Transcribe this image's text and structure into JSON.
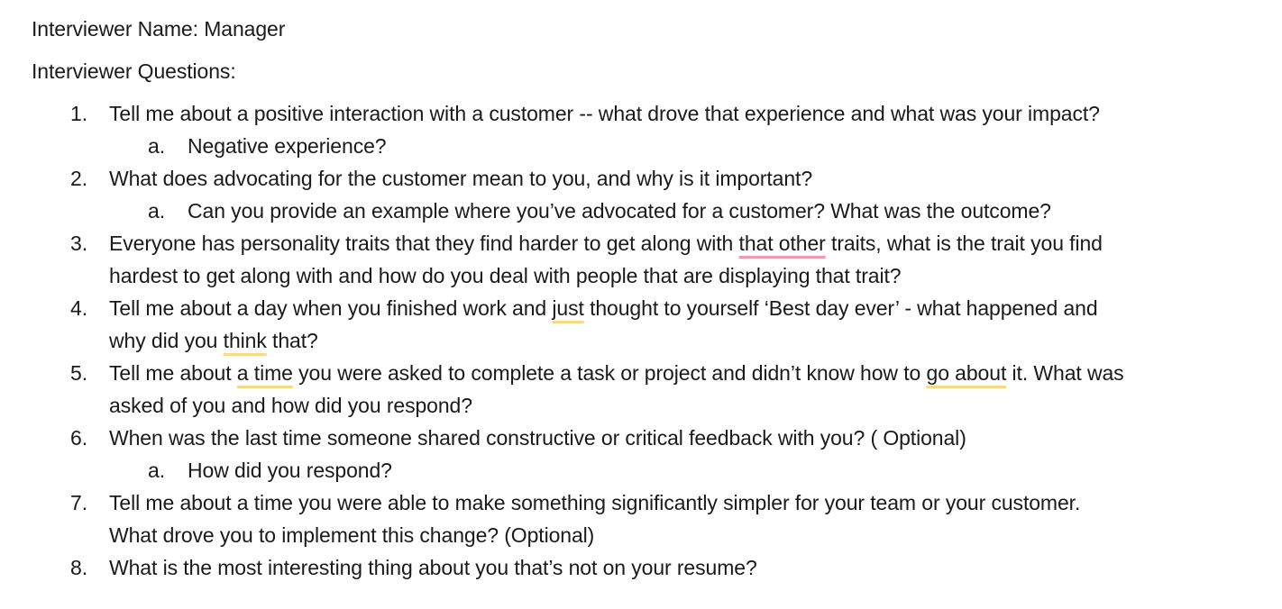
{
  "document": {
    "name_line": {
      "label": "Interviewer Name:",
      "value": "Manager"
    },
    "questions_heading": "Interviewer Questions:",
    "questions": [
      {
        "number": "1.",
        "lines": [
          [
            {
              "t": "Tell me about a positive interaction with a customer -- what drove that experience and what was your impact?"
            }
          ]
        ],
        "sub": [
          {
            "letter": "a.",
            "text": "Negative experience?"
          }
        ]
      },
      {
        "number": "2.",
        "lines": [
          [
            {
              "t": "What does advocating for the customer mean to you, and why is it important?"
            }
          ]
        ],
        "sub": [
          {
            "letter": "a.",
            "text": "Can you provide an example where you’ve advocated for a customer? What was the outcome?"
          }
        ]
      },
      {
        "number": "3.",
        "lines": [
          [
            {
              "t": "Everyone has personality traits that they find harder to get along with "
            },
            {
              "t": "that other",
              "mark": "spell"
            },
            {
              "t": " traits, what is the trait you find"
            }
          ],
          [
            {
              "t": "hardest to get along with and how do you deal with people that are displaying that trait?"
            }
          ]
        ],
        "sub": []
      },
      {
        "number": "4.",
        "lines": [
          [
            {
              "t": "Tell me about a day when you finished work and "
            },
            {
              "t": "just",
              "mark": "grammar"
            },
            {
              "t": " thought to yourself ‘Best day ever’ - what happened and"
            }
          ],
          [
            {
              "t": "why did you "
            },
            {
              "t": "think",
              "mark": "grammar"
            },
            {
              "t": " that?"
            }
          ]
        ],
        "sub": []
      },
      {
        "number": "5.",
        "lines": [
          [
            {
              "t": "Tell me about "
            },
            {
              "t": "a time",
              "mark": "grammar"
            },
            {
              "t": " you were asked to complete a task or project and didn’t know how to "
            },
            {
              "t": "go about",
              "mark": "grammar"
            },
            {
              "t": " it. What was"
            }
          ],
          [
            {
              "t": "asked of you and how did you respond?"
            }
          ]
        ],
        "sub": []
      },
      {
        "number": "6.",
        "lines": [
          [
            {
              "t": "When was the last time someone shared constructive or critical feedback with you? ( Optional)"
            }
          ]
        ],
        "sub": [
          {
            "letter": "a.",
            "text": "How did you respond?"
          }
        ]
      },
      {
        "number": "7.",
        "lines": [
          [
            {
              "t": "Tell me about a time you were able to make something significantly simpler for your team or your customer."
            }
          ],
          [
            {
              "t": "What drove you to implement this change? (Optional)"
            }
          ]
        ],
        "sub": []
      },
      {
        "number": "8.",
        "lines": [
          [
            {
              "t": "What is the most interesting thing about you that’s not on your resume?"
            }
          ]
        ],
        "sub": []
      }
    ]
  }
}
